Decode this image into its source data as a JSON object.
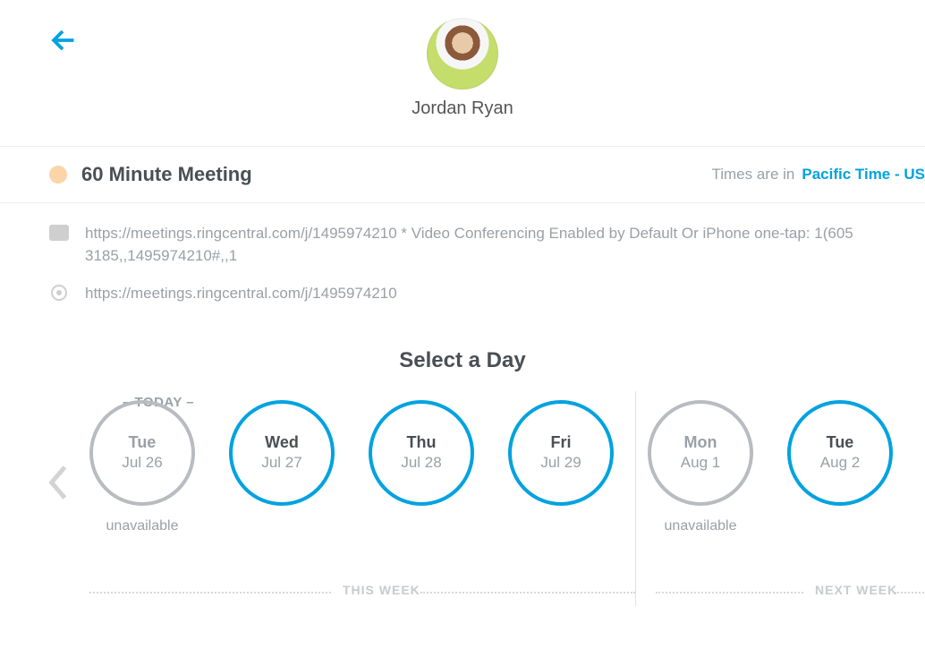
{
  "host_name": "Jordan Ryan",
  "meeting": {
    "title": "60 Minute Meeting",
    "dot_color": "#fbd5a8"
  },
  "timezone": {
    "label": "Times are in",
    "value": "Pacific Time - US"
  },
  "description": "https://meetings.ringcentral.com/j/1495974210 * Video Conferencing Enabled by Default Or iPhone one-tap: 1(605 3185,,1495974210#,,1",
  "location": "https://meetings.ringcentral.com/j/1495974210",
  "select_day_heading": "Select a Day",
  "today_flag": "– TODAY –",
  "unavailable_text": "unavailable",
  "week_labels": {
    "this": "THIS WEEK",
    "next": "NEXT WEEK"
  },
  "days": [
    {
      "dow": "Tue",
      "date": "Jul 26",
      "available": false
    },
    {
      "dow": "Wed",
      "date": "Jul 27",
      "available": true
    },
    {
      "dow": "Thu",
      "date": "Jul 28",
      "available": true
    },
    {
      "dow": "Fri",
      "date": "Jul 29",
      "available": true
    },
    {
      "dow": "Mon",
      "date": "Aug 1",
      "available": false
    },
    {
      "dow": "Tue",
      "date": "Aug 2",
      "available": true
    }
  ]
}
